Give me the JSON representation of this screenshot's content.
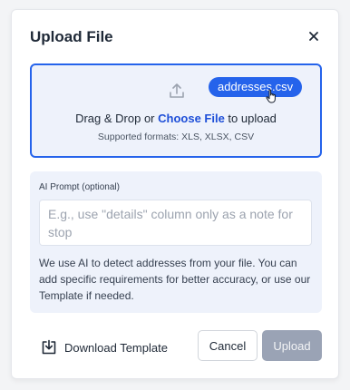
{
  "dialog": {
    "title": "Upload File",
    "close_icon": "close-icon"
  },
  "dropzone": {
    "icon": "upload-icon",
    "dragged_file": "addresses.csv",
    "cursor_icon": "hand-pointer-icon",
    "text_before": "Drag & Drop or ",
    "link": "Choose File",
    "text_after": " to upload",
    "formats": "Supported formats: XLS, XLSX, CSV"
  },
  "ai_prompt": {
    "label": "AI Prompt (optional)",
    "value": "",
    "placeholder": "E.g., use \"details\" column only as a note for stop",
    "help": "We use AI to detect addresses from your file. You can add specific requirements for better accuracy, or use our Template if needed."
  },
  "footer": {
    "download_icon": "download-icon",
    "download_label": "Download Template",
    "cancel_label": "Cancel",
    "upload_label": "Upload"
  },
  "colors": {
    "accent": "#2563eb",
    "panel_bg": "#eef2fb",
    "disabled_button": "#9aa3b5"
  }
}
